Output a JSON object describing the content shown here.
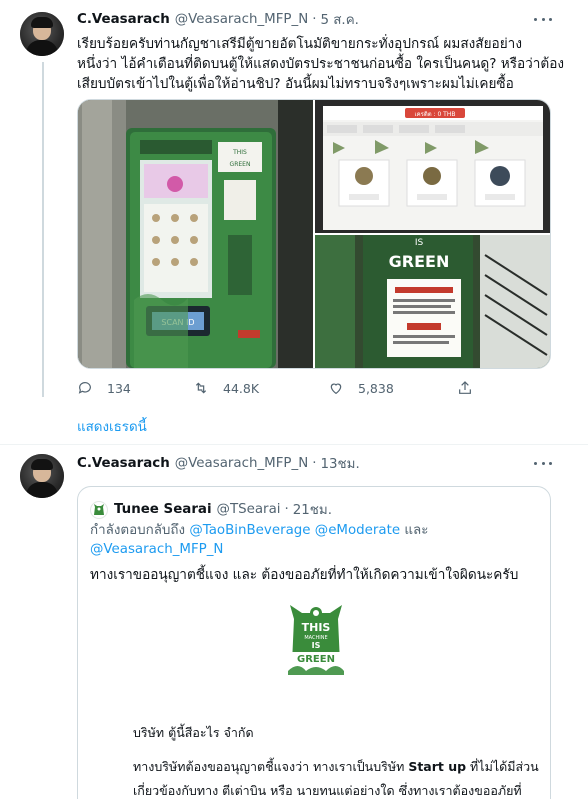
{
  "tweet1": {
    "name": "C.Veasarach",
    "handle": "@Veasarach_MFP_N",
    "separator": "·",
    "time": "5 ส.ค.",
    "text_lines": [
      "เรียบร้อยครับท่านกัญชาเสรีมีตู้ขายอัตโนมัติขายกระทั่งอุปกรณ์ ผมสงสัยอย่าง",
      "หนึ่งว่า ไอ้คำเตือนที่ติดบนตู้ให้แสดงบัตรประชาชนก่อนซื้อ ใครเป็นคนดู? หรือว่าต้อง",
      "เสียบบัตรเข้าไปในตู้เพื่อให้อ่านชิป? อันนี้ผมไม่ทราบจริงๆเพราะผมไม่เคยซื้อ"
    ],
    "media": {
      "machine_header": "THIS MACHINE IS GREEN",
      "screen_balance": "เครดิต : 0 THB",
      "scan_button": "SCAN ID",
      "sign_text": "IS GREEN"
    },
    "stats": {
      "replies": "134",
      "retweets": "44.8K",
      "likes": "5,838"
    }
  },
  "show_thread": "แสดงเธรดนี้",
  "tweet2": {
    "name": "C.Veasarach",
    "handle": "@Veasarach_MFP_N",
    "separator": "·",
    "time": "13ชม.",
    "quote": {
      "name": "Tunee Searai",
      "handle": "@TSearai",
      "separator": "·",
      "time": "21ชม.",
      "reply_prefix": "กำลังตอบกลับถึง",
      "mention1": "@TaoBinBeverage",
      "mention2": "@eModerate",
      "reply_and": "และ",
      "mention3": "@Veasarach_MFP_N",
      "text": "ทางเราขออนุญาตชี้แจง และ ต้องขออภัยที่ทำให้เกิดความเข้าใจผิดนะครับ",
      "logo_lines": [
        "THIS",
        "MACHINE",
        "IS",
        "GREEN"
      ],
      "company": "บริษัท ตู้นี้สีอะไร จำกัด",
      "para_line1_a": "ทางบริษัทต้องขออนุญาตชี้แจงว่า ทางเราเป็นบริษัท ",
      "para_line1_b": "Start up",
      "para_line1_c": " ที่ไม่ได้มีส่วน",
      "para_line2": "เกี่ยวข้องกับทาง ตีเต่าบิน หรือ นายทนแต่อย่างใด ซึ่งทางเราต้องขออภัยที่"
    }
  },
  "colors": {
    "accent": "#1d9bf0",
    "secondary_text": "#536471",
    "border": "#cfd9de",
    "brand_green": "#3a8c3b"
  }
}
